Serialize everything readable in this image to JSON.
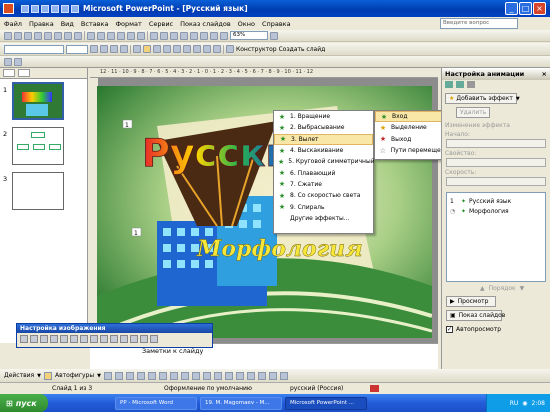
{
  "window": {
    "title": "Microsoft PowerPoint - [Русский язык]"
  },
  "menubar": {
    "items": [
      "Файл",
      "Правка",
      "Вид",
      "Вставка",
      "Формат",
      "Сервис",
      "Показ слайдов",
      "Окно",
      "Справка"
    ],
    "help_placeholder": "Введите вопрос"
  },
  "toolbar": {
    "zoom": "63%",
    "designer_label": "Конструктор",
    "new_slide_label": "Создать слайд"
  },
  "slides_panel": {
    "numbers": [
      "1",
      "2",
      "3"
    ]
  },
  "slide": {
    "title_text": "Русский",
    "subtitle_text": "Морфология",
    "placeholder_number": "1",
    "placeholder_number2": "1"
  },
  "effects_menu": {
    "items": [
      {
        "label": "1. Вращение"
      },
      {
        "label": "2. Выбрасывание"
      },
      {
        "label": "3. Вылет"
      },
      {
        "label": "4. Выскакивание"
      },
      {
        "label": "5. Круговой симметричный"
      },
      {
        "label": "6. Плавающий"
      },
      {
        "label": "7. Сжатие"
      },
      {
        "label": "8. Со скоростью света"
      },
      {
        "label": "9. Спираль"
      },
      {
        "label": "Другие эффекты..."
      }
    ],
    "selected_index": 2
  },
  "category_menu": {
    "items": [
      "Вход",
      "Выделение",
      "Выход",
      "Пути перемещения"
    ],
    "selected_index": 0
  },
  "task_pane": {
    "title": "Настройка анимации",
    "add_effect_label": "Добавить эффект",
    "remove_label": "Удалить",
    "change_effect_label": "Изменение эффекта",
    "start_label": "Начало:",
    "property_label": "Свойство:",
    "speed_label": "Скорость:",
    "list_items": [
      {
        "number": "1",
        "label": "Русский язык"
      },
      {
        "number": "",
        "label": "Морфология"
      }
    ],
    "order_label": "Порядок",
    "preview_label": "Просмотр",
    "slideshow_label": "Показ слайдов",
    "autopreview_label": "Автопросмотр"
  },
  "picture_toolbar": {
    "title": "Настройка изображения"
  },
  "notes": {
    "placeholder": "Заметки к слайду"
  },
  "draw_toolbar": {
    "actions_label": "Действия",
    "autoshapes_label": "Автофигуры"
  },
  "status_bar": {
    "slide_info": "Слайд 1 из 3",
    "design": "Оформление по умолчанию",
    "language": "русский (Россия)"
  },
  "taskbar": {
    "start_label": "пуск",
    "tasks": [
      "PP - Microsoft Word",
      "19. M. Magomaev - M...",
      "Microsoft PowerPoint ..."
    ],
    "active_index": 2,
    "lang": "RU",
    "clock": "2:08"
  },
  "colors": {
    "title_bar": "#0a5fd8",
    "menu_highlight": "#f9e7a8",
    "slide_bg": "#2f7a34"
  }
}
